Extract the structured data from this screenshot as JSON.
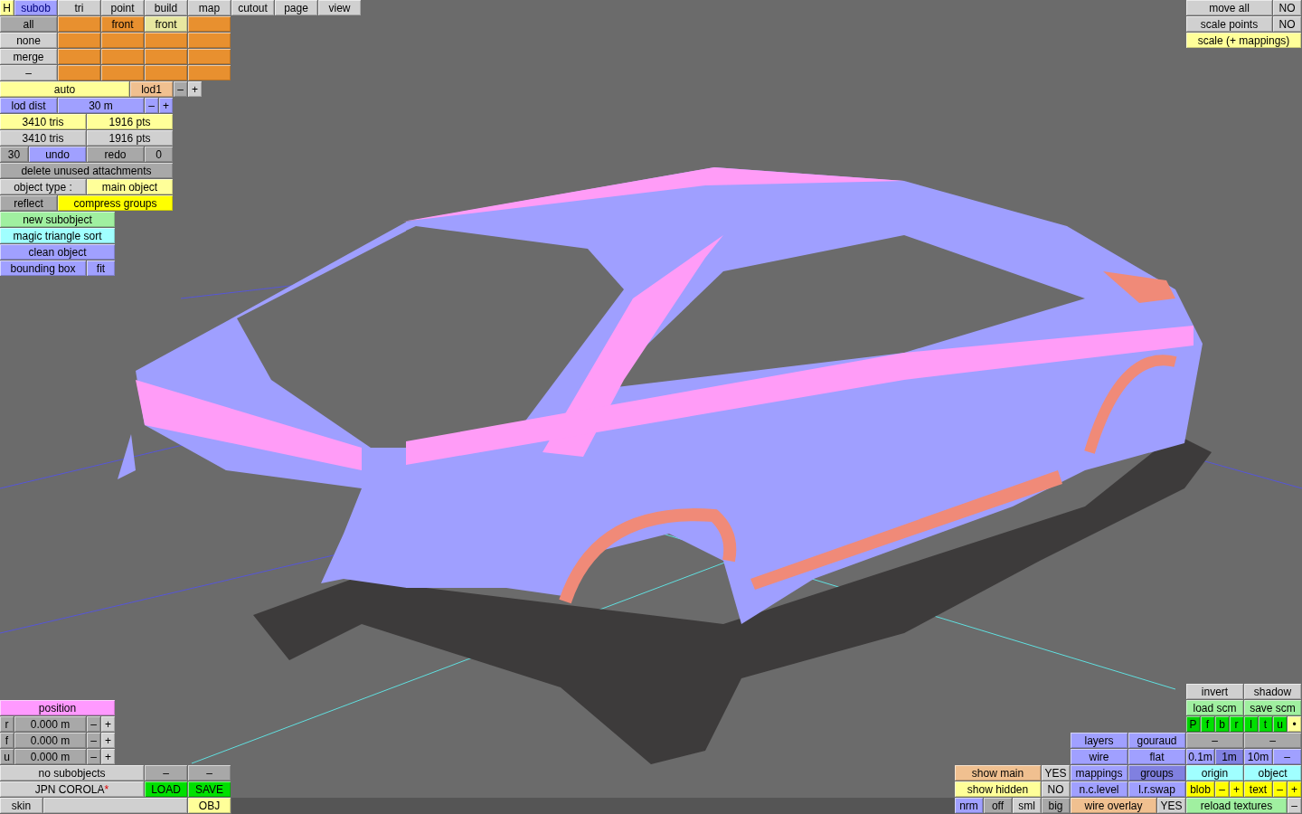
{
  "tabs": [
    {
      "label": "H",
      "color": "#ffff99",
      "selected": false
    },
    {
      "label": "subob",
      "color": "#a0a0ff",
      "selected": true
    },
    {
      "label": "tri",
      "color": "#d0d0d0",
      "selected": false
    },
    {
      "label": "point",
      "color": "#d0d0d0",
      "selected": false
    },
    {
      "label": "build",
      "color": "#d0d0d0",
      "selected": false
    },
    {
      "label": "map",
      "color": "#d0d0d0",
      "selected": false
    },
    {
      "label": "cutout",
      "color": "#d0d0d0",
      "selected": false
    },
    {
      "label": "page",
      "color": "#d0d0d0",
      "selected": false
    },
    {
      "label": "view",
      "color": "#d0d0d0",
      "selected": false
    }
  ],
  "subobject_panel": [
    [
      {
        "label": "all",
        "color": "#a8a8a8"
      },
      {
        "color": "#e8902f"
      },
      {
        "label": "front",
        "color": "#e8902f"
      },
      {
        "label": "front",
        "color": "#e8e8a0"
      },
      {
        "color": "#e8902f"
      }
    ],
    [
      {
        "label": "none",
        "color": "#d0d0d0"
      },
      {
        "color": "#e8902f"
      },
      {
        "color": "#e8902f"
      },
      {
        "color": "#e8902f"
      },
      {
        "color": "#e8902f"
      }
    ],
    [
      {
        "label": "merge",
        "color": "#d0d0d0"
      },
      {
        "color": "#e8902f"
      },
      {
        "color": "#e8902f"
      },
      {
        "color": "#e8902f"
      },
      {
        "color": "#e8902f"
      }
    ],
    [
      {
        "label": "–",
        "color": "#d0d0d0"
      },
      {
        "color": "#e8902f"
      },
      {
        "color": "#e8902f"
      },
      {
        "color": "#e8902f"
      },
      {
        "color": "#e8902f"
      }
    ],
    [
      {
        "label": "auto",
        "color": "#ffff99"
      },
      {
        "label": "lod1",
        "color": "#f0c090"
      },
      {
        "label": "–",
        "color": "#a8a8a8"
      },
      {
        "label": "+",
        "color": "#d0d0d0"
      }
    ],
    [
      {
        "label": "lod dist",
        "color": "#a0a0ff"
      },
      {
        "label": "30 m",
        "color": "#a0a0ff"
      },
      {
        "label": "–",
        "color": "#a0a0ff"
      },
      {
        "label": "+",
        "color": "#a0a0ff"
      }
    ],
    [
      {
        "label": "3410 tris",
        "color": "#ffff99"
      },
      {
        "label": "1916 pts",
        "color": "#ffff99"
      }
    ],
    [
      {
        "label": "3410 tris",
        "color": "#d0d0d0"
      },
      {
        "label": "1916 pts",
        "color": "#d0d0d0"
      }
    ],
    [
      {
        "label": "30",
        "color": "#a8a8a8"
      },
      {
        "label": "undo",
        "color": "#a0a0ff"
      },
      {
        "label": "redo",
        "color": "#a8a8a8"
      },
      {
        "label": "0",
        "color": "#a8a8a8"
      }
    ],
    [
      {
        "label": "delete unused attachments",
        "color": "#a8a8a8"
      }
    ],
    [
      {
        "label": "object type :",
        "color": "#d0d0d0"
      },
      {
        "label": "main object",
        "color": "#ffff99"
      }
    ],
    [
      {
        "label": "reflect",
        "color": "#a8a8a8"
      },
      {
        "label": "compress groups",
        "color": "#ffff00"
      }
    ],
    [
      {
        "label": "new subobject",
        "color": "#a0f0a0"
      }
    ],
    [
      {
        "label": "magic triangle sort",
        "color": "#a0ffff"
      }
    ],
    [
      {
        "label": "clean object",
        "color": "#a0a0ff"
      }
    ],
    [
      {
        "label": "bounding box",
        "color": "#a0a0ff"
      },
      {
        "label": "fit",
        "color": "#a0a0ff"
      }
    ]
  ],
  "move_panel": [
    [
      {
        "label": "move all",
        "color": "#d0d0d0"
      },
      {
        "label": "NO",
        "color": "#d0d0d0"
      }
    ],
    [
      {
        "label": "scale points",
        "color": "#d0d0d0"
      },
      {
        "label": "NO",
        "color": "#d0d0d0"
      }
    ],
    [
      {
        "label": "scale (+ mappings)",
        "color": "#ffff99"
      }
    ]
  ],
  "position_panel": [
    [
      {
        "label": "position",
        "color": "#ff99ff"
      }
    ],
    [
      {
        "label": "r",
        "color": "#a8a8a8"
      },
      {
        "label": "0.000 m",
        "color": "#a8a8a8"
      },
      {
        "label": "–",
        "color": "#a8a8a8"
      },
      {
        "label": "+",
        "color": "#d0d0d0"
      }
    ],
    [
      {
        "label": "f",
        "color": "#a8a8a8"
      },
      {
        "label": "0.000 m",
        "color": "#a8a8a8"
      },
      {
        "label": "–",
        "color": "#a8a8a8"
      },
      {
        "label": "+",
        "color": "#d0d0d0"
      }
    ],
    [
      {
        "label": "u",
        "color": "#a8a8a8"
      },
      {
        "label": "0.000 m",
        "color": "#a8a8a8"
      },
      {
        "label": "–",
        "color": "#a8a8a8"
      },
      {
        "label": "+",
        "color": "#d0d0d0"
      }
    ],
    [
      {
        "label": "no subobjects",
        "color": "#d0d0d0"
      },
      {
        "label": "–",
        "color": "#a8a8a8"
      },
      {
        "label": "–",
        "color": "#a8a8a8"
      }
    ],
    [
      {
        "label": "JPN COROLA",
        "suffix": "*",
        "color": "#d0d0d0"
      },
      {
        "label": "LOAD",
        "color": "#00e000"
      },
      {
        "label": "SAVE",
        "color": "#00e000"
      }
    ],
    [
      {
        "label": "skin",
        "color": "#d0d0d0"
      },
      {
        "color": "#d0d0d0"
      },
      {
        "label": "OBJ",
        "color": "#ffff99"
      }
    ]
  ],
  "view_panel": [
    [
      {
        "label": "invert",
        "color": "#d0d0d0"
      },
      {
        "label": "shadow",
        "color": "#d0d0d0"
      }
    ],
    [
      {
        "label": "load scm",
        "color": "#a0f0a0"
      },
      {
        "label": "save scm",
        "color": "#a0f0a0"
      }
    ],
    [
      {
        "label": "P",
        "color": "#00d000"
      },
      {
        "label": "f",
        "color": "#00e000"
      },
      {
        "label": "b",
        "color": "#00e000"
      },
      {
        "label": "r",
        "color": "#00e000"
      },
      {
        "label": "l",
        "color": "#00e000"
      },
      {
        "label": "t",
        "color": "#00e000"
      },
      {
        "label": "u",
        "color": "#00e000"
      },
      {
        "label": "•",
        "color": "#ffff99"
      }
    ],
    [
      {
        "label": "layers",
        "color": "#a0a0ff"
      },
      {
        "label": "gouraud",
        "color": "#a0a0ff"
      },
      {
        "label": "–",
        "color": "#a8a8a8"
      },
      {
        "label": "–",
        "color": "#a8a8a8"
      }
    ],
    [
      {
        "label": "wire",
        "color": "#a0a0ff"
      },
      {
        "label": "flat",
        "color": "#a0a0ff"
      },
      {
        "label": "0.1m",
        "color": "#a0a0ff"
      },
      {
        "label": "1m",
        "color": "#8080e0"
      },
      {
        "label": "10m",
        "color": "#a0a0ff"
      },
      {
        "label": "–",
        "color": "#a0a0ff"
      }
    ],
    [
      {
        "label": "show main",
        "color": "#f0c090"
      },
      {
        "label": "YES",
        "color": "#d0d0d0"
      },
      {
        "label": "mappings",
        "color": "#a0a0ff"
      },
      {
        "label": "groups",
        "color": "#8080e0"
      },
      {
        "label": "origin",
        "color": "#a0ffff"
      },
      {
        "label": "object",
        "color": "#a0ffff"
      }
    ],
    [
      {
        "label": "show hidden",
        "color": "#ffff99"
      },
      {
        "label": "NO",
        "color": "#d0d0d0"
      },
      {
        "label": "n.c.level",
        "color": "#a0a0ff"
      },
      {
        "label": "l.r.swap",
        "color": "#a0a0ff"
      },
      {
        "label": "blob",
        "color": "#ffff00"
      },
      {
        "label": "–",
        "color": "#ffff00"
      },
      {
        "label": "+",
        "color": "#ffff00"
      },
      {
        "label": "text",
        "color": "#ffff00"
      },
      {
        "label": "–",
        "color": "#ffff00"
      },
      {
        "label": "+",
        "color": "#ffff00"
      }
    ],
    [
      {
        "label": "nrm",
        "color": "#a0a0ff"
      },
      {
        "label": "off",
        "color": "#a8a8a8"
      },
      {
        "label": "sml",
        "color": "#d0d0d0"
      },
      {
        "label": "big",
        "color": "#a8a8a8"
      },
      {
        "label": "wire overlay",
        "color": "#f0c090"
      },
      {
        "label": "YES",
        "color": "#d0d0d0"
      },
      {
        "label": "reload textures",
        "color": "#a0f0a0"
      },
      {
        "label": "–",
        "color": "#d0d0d0"
      }
    ]
  ]
}
